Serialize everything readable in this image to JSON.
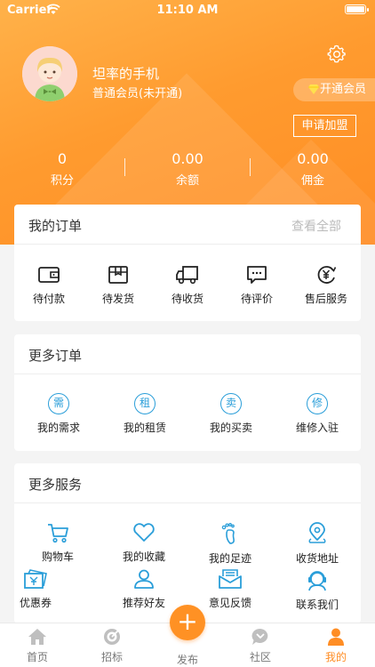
{
  "status_bar": {
    "carrier": "Carrier",
    "time": "11:10 AM"
  },
  "profile": {
    "username": "坦率的手机",
    "level": "普通会员(未开通)",
    "open_vip": "开通会员",
    "apply_join": "申请加盟"
  },
  "stats": [
    {
      "value": "0",
      "label": "积分"
    },
    {
      "value": "0.00",
      "label": "余额"
    },
    {
      "value": "0.00",
      "label": "佣金"
    }
  ],
  "my_orders": {
    "title": "我的订单",
    "view_all": "查看全部",
    "items": [
      {
        "label": "待付款",
        "icon": "wallet-icon"
      },
      {
        "label": "待发货",
        "icon": "package-icon"
      },
      {
        "label": "待收货",
        "icon": "truck-icon"
      },
      {
        "label": "待评价",
        "icon": "comment-icon"
      },
      {
        "label": "售后服务",
        "icon": "yen-refund-icon"
      }
    ]
  },
  "more_orders": {
    "title": "更多订单",
    "items": [
      {
        "label": "我的需求",
        "glyph": "需"
      },
      {
        "label": "我的租赁",
        "glyph": "租"
      },
      {
        "label": "我的买卖",
        "glyph": "卖"
      },
      {
        "label": "维修入驻",
        "glyph": "修"
      }
    ]
  },
  "more_services": {
    "title": "更多服务",
    "items": [
      {
        "label": "购物车",
        "icon": "cart-icon"
      },
      {
        "label": "我的收藏",
        "icon": "heart-icon"
      },
      {
        "label": "我的足迹",
        "icon": "footprint-icon"
      },
      {
        "label": "收货地址",
        "icon": "location-icon"
      },
      {
        "label": "优惠券",
        "icon": "coupon-icon"
      },
      {
        "label": "推荐好友",
        "icon": "person-icon"
      },
      {
        "label": "意见反馈",
        "icon": "mail-icon"
      },
      {
        "label": "联系我们",
        "icon": "customer-service-icon"
      }
    ]
  },
  "tabbar": {
    "tabs": [
      {
        "label": "首页",
        "icon": "home-icon",
        "active": false
      },
      {
        "label": "招标",
        "icon": "target-icon",
        "active": false
      },
      {
        "label": "发布",
        "icon": "plus-icon",
        "active": false
      },
      {
        "label": "社区",
        "icon": "chat-bubble-icon",
        "active": false
      },
      {
        "label": "我的",
        "icon": "user-icon",
        "active": true
      }
    ],
    "publish_symbol": "+"
  },
  "colors": {
    "primary": "#ff9124",
    "accent_blue": "#2a9ed9",
    "active_tab": "#ff8d24"
  }
}
